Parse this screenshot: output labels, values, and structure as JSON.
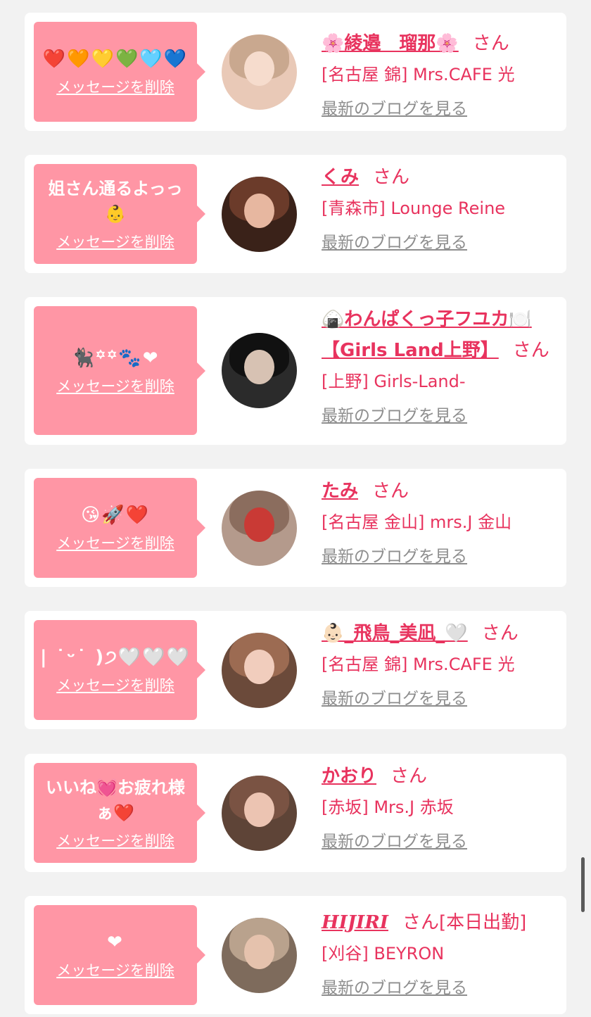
{
  "colors": {
    "bubble": "#ff96a5",
    "accent": "#e8335e",
    "link_gray": "#8e8e8e",
    "card": "#ffffff",
    "page": "#f2f2f2"
  },
  "delete_label": "メッセージを削除",
  "blog_label": "最新のブログを見る",
  "entries": [
    {
      "message": "❤️🧡💛💚🩵💙",
      "emoji_only": true,
      "name": "🌸綾邉　瑠那🌸",
      "suffix": "さん",
      "shop": "[名古屋 錦] Mrs.CAFE 光",
      "avatar": [
        "#e9c9b7",
        "#f6dccd",
        "#c9a88f"
      ]
    },
    {
      "message": "姐さん通るよっっ\n👶",
      "emoji_only": false,
      "name": "くみ",
      "suffix": "さん",
      "shop": "[青森市] Lounge Reine",
      "avatar": [
        "#3a2219",
        "#e7b7a0",
        "#6b3b2a"
      ]
    },
    {
      "message": "🐈‍⬛꙳꙳🐾❤",
      "emoji_only": true,
      "name": "🍙わんぱくっ子フユカ🍽️【Girls Land上野】",
      "suffix": "さん",
      "shop": "[上野] Girls-Land-",
      "avatar": [
        "#2b2b2b",
        "#d7c2b3",
        "#111111"
      ]
    },
    {
      "message": "😘🚀❤️",
      "emoji_only": true,
      "name": "たみ",
      "suffix": "さん",
      "shop": "[名古屋 金山] mrs.J 金山",
      "avatar": [
        "#b49a8c",
        "#c93a35",
        "#8b6d5e"
      ]
    },
    {
      "message": "| ˙ᵕ˙ )੭🤍🤍🤍",
      "emoji_only": true,
      "name": "👶🏻_飛鳥_美凪_🤍",
      "suffix": "さん",
      "shop": "[名古屋 錦] Mrs.CAFE 光",
      "avatar": [
        "#6b4a3a",
        "#f1cdbd",
        "#9c6b52"
      ]
    },
    {
      "message": "いいね💓お疲れ様\nぁ❤️",
      "emoji_only": false,
      "name": "かおり",
      "suffix": "さん",
      "shop": "[赤坂] Mrs.J 赤坂",
      "avatar": [
        "#5e4437",
        "#ecc4b2",
        "#7a5343"
      ]
    },
    {
      "message": "❤",
      "emoji_only": true,
      "name": "HIJIRI",
      "suffix": "さん[本日出勤]",
      "shop": "[刈谷] BEYRON",
      "avatar": [
        "#7e6b5c",
        "#e5c2ad",
        "#b9a28d"
      ],
      "italic_name": true
    }
  ]
}
